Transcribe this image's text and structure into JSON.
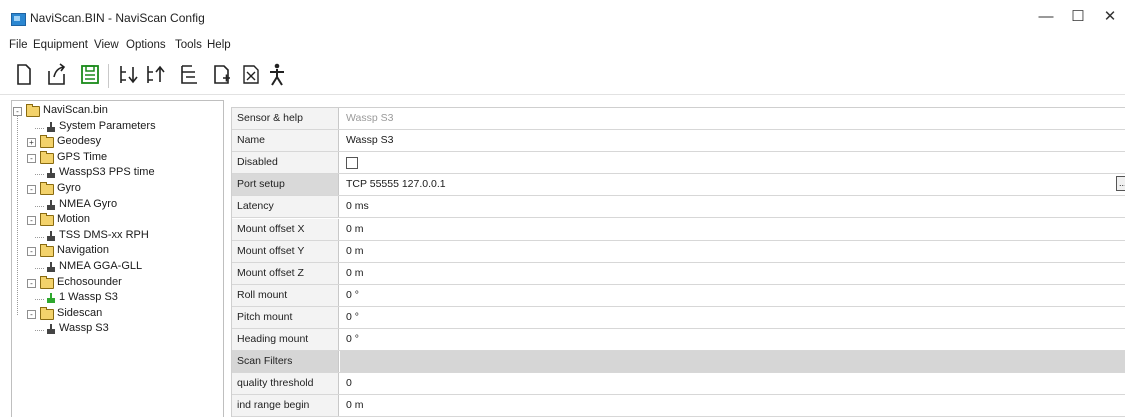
{
  "window": {
    "title": "NaviScan.BIN - NaviScan Config",
    "minimize_glyph": "—",
    "maximize_glyph": "☐",
    "close_glyph": "✕"
  },
  "menu": [
    "File",
    "Equipment",
    "View",
    "Options",
    "Tools",
    "Help"
  ],
  "toolbar": {
    "buttons": [
      "new-file-icon",
      "export-icon",
      "save-icon",
      "move-down-icon",
      "move-up-icon",
      "tree-icon",
      "add-document-icon",
      "delete-icon",
      "run-icon"
    ],
    "accent_save": "#1a8a1a"
  },
  "tree": {
    "nodes": [
      {
        "label": "NaviScan.bin",
        "type": "folder",
        "expander": "-"
      },
      {
        "label": "System Parameters",
        "type": "leaf"
      },
      {
        "label": "Geodesy",
        "type": "folder",
        "expander": "+"
      },
      {
        "label": "GPS Time",
        "type": "folder",
        "expander": "-"
      },
      {
        "label": "WasspS3 PPS time",
        "type": "leaf"
      },
      {
        "label": "Gyro",
        "type": "folder",
        "expander": "-"
      },
      {
        "label": "NMEA Gyro",
        "type": "leaf"
      },
      {
        "label": "Motion",
        "type": "folder",
        "expander": "-"
      },
      {
        "label": "TSS DMS-xx RPH",
        "type": "leaf"
      },
      {
        "label": "Navigation",
        "type": "folder",
        "expander": "-"
      },
      {
        "label": "NMEA GGA-GLL",
        "type": "leaf"
      },
      {
        "label": "Echosounder",
        "type": "folder",
        "expander": "-"
      },
      {
        "label": "1 Wassp S3",
        "type": "leaf",
        "active": true
      },
      {
        "label": "Sidescan",
        "type": "folder",
        "expander": "-"
      },
      {
        "label": "Wassp S3",
        "type": "leaf"
      }
    ]
  },
  "properties": {
    "rows": [
      {
        "label": "Sensor & help",
        "value": "Wassp S3",
        "state": "disabled"
      },
      {
        "label": "Name",
        "value": "Wassp S3",
        "state": "normal"
      },
      {
        "label": "Disabled",
        "value": "",
        "state": "checkbox"
      },
      {
        "label": "Port setup",
        "value": "TCP 55555 127.0.0.1",
        "state": "selected"
      },
      {
        "label": "Latency",
        "value": "0 ms",
        "state": "normal"
      },
      {
        "label": "Mount offset X",
        "value": "0 m",
        "state": "normal"
      },
      {
        "label": "Mount offset Y",
        "value": "0 m",
        "state": "normal"
      },
      {
        "label": "Mount offset Z",
        "value": "0 m",
        "state": "normal"
      },
      {
        "label": "Roll mount",
        "value": "0 °",
        "state": "normal"
      },
      {
        "label": "Pitch mount",
        "value": "0 °",
        "state": "normal"
      },
      {
        "label": "Heading mount",
        "value": "0 °",
        "state": "normal"
      },
      {
        "label": "Scan Filters",
        "value": "",
        "state": "category"
      },
      {
        "label": "quality threshold",
        "value": "0",
        "state": "normal"
      },
      {
        "label": "ind range begin",
        "value": "0 m",
        "state": "normal"
      }
    ],
    "ellipsis_label": "..."
  }
}
